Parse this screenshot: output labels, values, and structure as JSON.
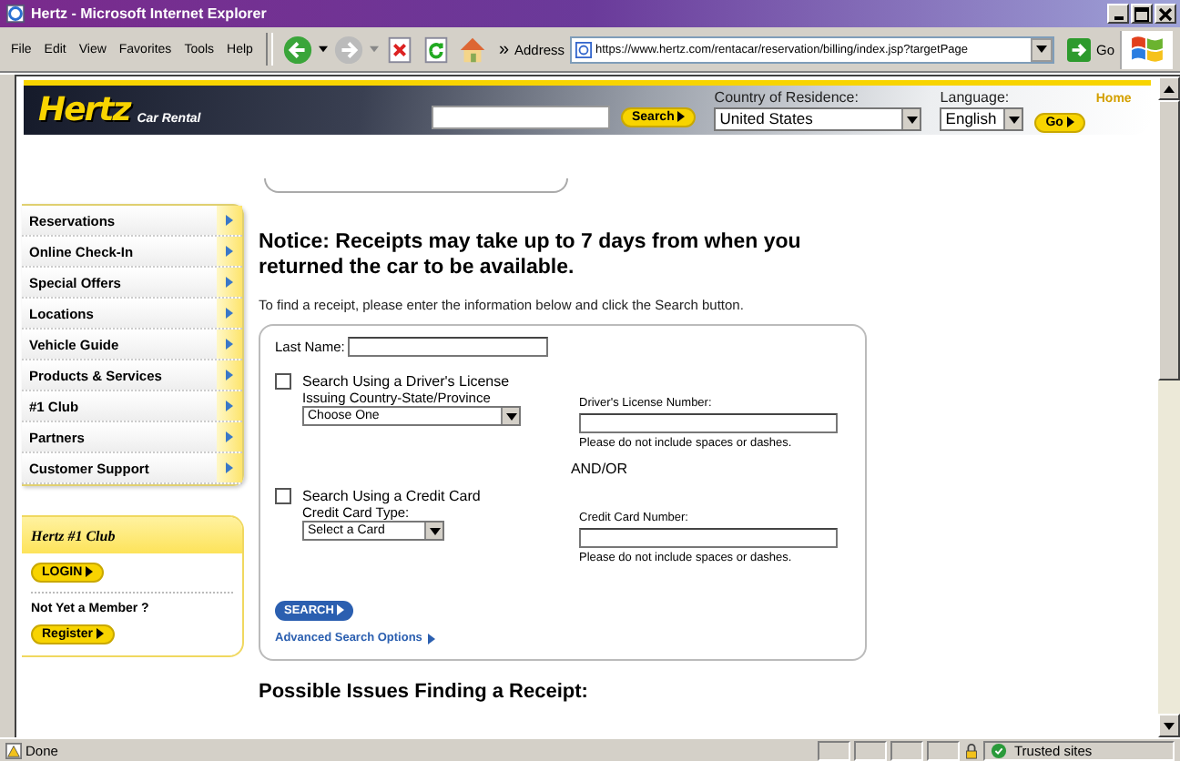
{
  "window": {
    "title": "Hertz - Microsoft Internet Explorer"
  },
  "menu": [
    "File",
    "Edit",
    "View",
    "Favorites",
    "Tools",
    "Help"
  ],
  "toolbar": {
    "chevron": "»",
    "address_label": "Address",
    "address": "https://www.hertz.com/rentacar/reservation/billing/index.jsp?targetPage",
    "go": "Go"
  },
  "header": {
    "logo": "Hertz",
    "tagline": "Car Rental",
    "search_button": "Search",
    "country_label": "Country of Residence:",
    "country": "United States",
    "language_label": "Language:",
    "language": "English",
    "go_button": "Go",
    "home_link": "Home"
  },
  "sidebar": {
    "items": [
      "Reservations",
      "Online Check-In",
      "Special Offers",
      "Locations",
      "Vehicle Guide",
      "Products & Services",
      "#1 Club",
      "Partners",
      "Customer Support"
    ]
  },
  "club": {
    "logo": "Hertz #1 Club",
    "login": "LOGIN",
    "member_prompt": "Not Yet a Member ?",
    "register": "Register"
  },
  "notice": "Notice: Receipts may take up to 7 days from when you returned the car to be available.",
  "intro": "To find a receipt, please enter the information below and click the Search button.",
  "form": {
    "last_name_label": "Last Name:",
    "sections": [
      {
        "checkbox_label": "Search Using a Driver's License",
        "checked": false,
        "select_label": "Issuing Country-State/Province",
        "select_value": "Choose One",
        "input_label": "Driver's License Number:",
        "note": "Please do not include spaces or dashes."
      },
      {
        "checkbox_label": "Search Using a Credit Card",
        "checked": false,
        "select_label": "Credit Card Type:",
        "select_value": "Select a Card",
        "input_label": "Credit Card Number:",
        "note": "Please do not include spaces or dashes."
      }
    ],
    "separator": "AND/OR",
    "search_button": "SEARCH",
    "advanced_link": "Advanced Search Options"
  },
  "issues_heading": "Possible Issues Finding a Receipt:",
  "status_bar": {
    "text": "Done",
    "zone": "Trusted sites"
  }
}
